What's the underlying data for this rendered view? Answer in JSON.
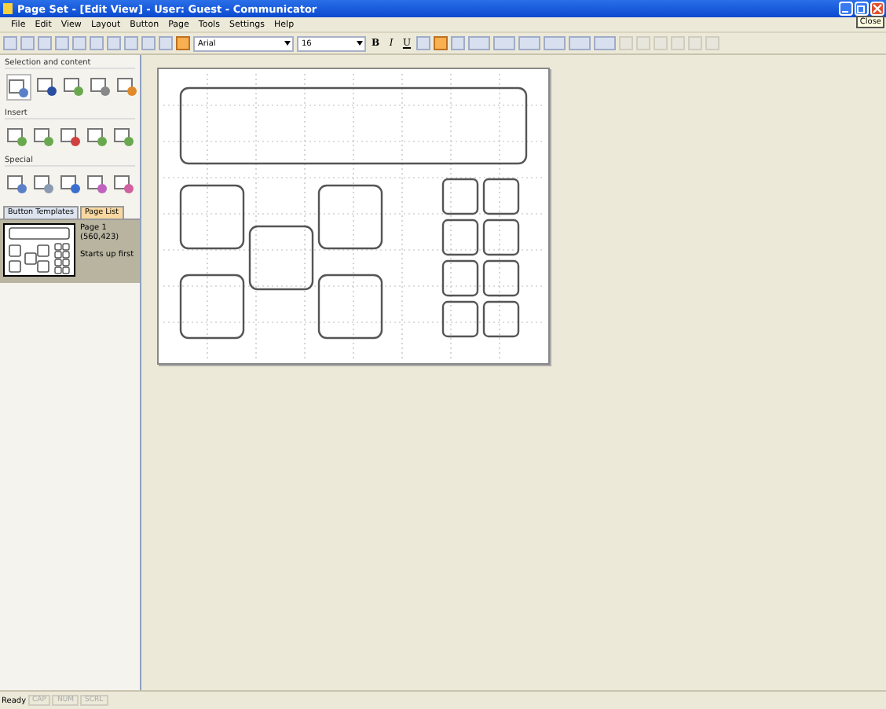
{
  "window": {
    "title": "Page Set - [Edit View] - User: Guest - Communicator",
    "tooltip": "Close"
  },
  "menu": [
    "File",
    "Edit",
    "View",
    "Layout",
    "Button",
    "Page",
    "Tools",
    "Settings",
    "Help"
  ],
  "toolbar": {
    "font": "Arial",
    "size": "16",
    "styles": [
      "B",
      "I",
      "U"
    ],
    "align": [
      {
        "selected": false
      },
      {
        "selected": true
      },
      {
        "selected": false
      }
    ],
    "mode_selected": true
  },
  "palette": [
    {
      "title": "Selection and content"
    },
    {
      "title": "Insert"
    },
    {
      "title": "Special"
    }
  ],
  "tabs": [
    {
      "label": "Button Templates",
      "selected": false
    },
    {
      "label": "Page List",
      "selected": true
    }
  ],
  "pages": [
    {
      "name": "Page 1",
      "size": "(560,423)",
      "note": "Starts up first",
      "selected": true
    }
  ],
  "status": {
    "text": "Ready",
    "indicators": [
      "CAP",
      "NUM",
      "SCRL"
    ]
  }
}
